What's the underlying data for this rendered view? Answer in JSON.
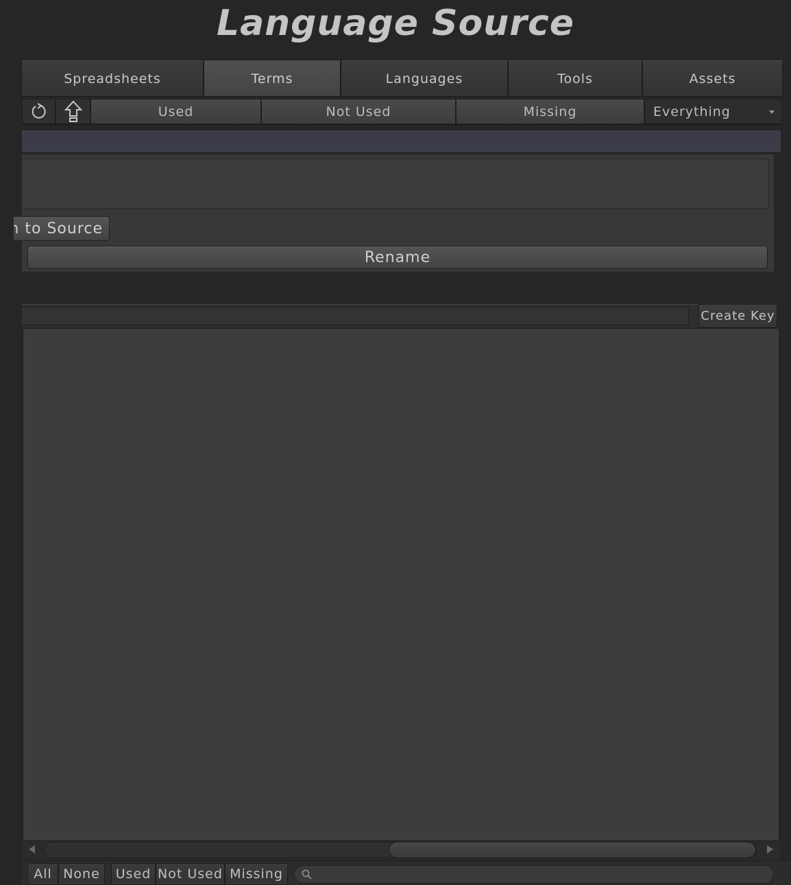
{
  "window": {
    "title": "Language Source"
  },
  "tabs": [
    {
      "label": "Spreadsheets"
    },
    {
      "label": "Terms",
      "active": true
    },
    {
      "label": "Languages"
    },
    {
      "label": "Tools"
    },
    {
      "label": "Assets"
    }
  ],
  "toolbar": {
    "refresh_icon": "refresh-icon",
    "upload_icon": "upload-arrow-icon",
    "filters": [
      "Used",
      "Not Used",
      "Missing"
    ],
    "dropdown_value": "Everything"
  },
  "term_panel": {
    "source_button_label": "n to Source",
    "rename_button_label": "Rename"
  },
  "create_key": {
    "button_label": "Create Key"
  },
  "footer": {
    "buttons": [
      "All",
      "None",
      "Used",
      "Not Used",
      "Missing"
    ],
    "search_icon": "search-icon"
  },
  "colors": {
    "background": "#262626",
    "selected_row": "#3b3c48",
    "list_background": "#3d3d3d"
  }
}
